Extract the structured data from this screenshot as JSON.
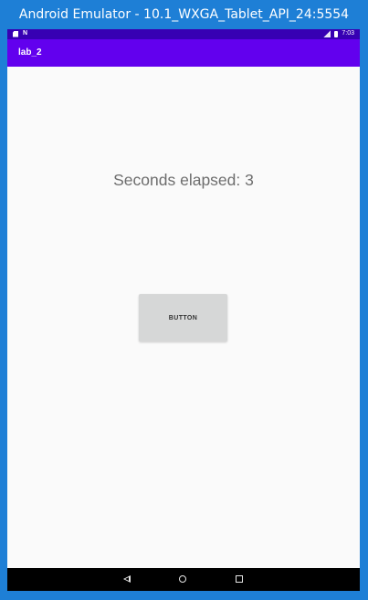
{
  "window": {
    "title": "Android Emulator - 10.1_WXGA_Tablet_API_24:5554"
  },
  "status_bar": {
    "left_icons": [
      "sim-card-icon",
      "n-notification-icon"
    ],
    "right_icons": [
      "signal-icon",
      "battery-icon"
    ],
    "time": "7:03"
  },
  "app_bar": {
    "title": "lab_2"
  },
  "main": {
    "elapsed_text": "Seconds elapsed: 3",
    "button_label": "BUTTON"
  },
  "nav_bar": {
    "icons": [
      "back-icon",
      "home-icon",
      "recents-icon"
    ]
  },
  "colors": {
    "app_bar": "#6200ee",
    "status_bar": "#3700b3",
    "window_frame": "#1e7fd6",
    "button": "#d6d7d7"
  }
}
